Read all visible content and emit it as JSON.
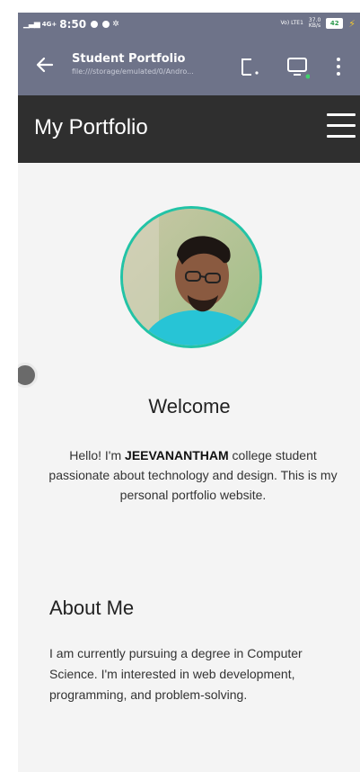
{
  "status_bar": {
    "network": "4G+",
    "time": "8:50",
    "volte": "Vo) LTE1",
    "speed_value": "37.0",
    "speed_unit": "KB/s",
    "battery": "42"
  },
  "browser": {
    "title": "Student Portfolio",
    "url": "file:///storage/emulated/0/Andro..."
  },
  "site": {
    "title": "My Portfolio"
  },
  "hero": {
    "welcome": "Welcome",
    "intro_prefix": "Hello! I'm ",
    "name": "JEEVANANTHAM",
    "intro_suffix": " college student passionate about technology and design. This is my personal portfolio website."
  },
  "about": {
    "heading": "About Me",
    "text": "I am currently pursuing a degree in Computer Science. I'm interested in web development, programming, and problem-solving."
  },
  "colors": {
    "chrome": "#6e7389",
    "header": "#2f2f2f",
    "avatar_border": "#22c3a6",
    "background": "#f4f4f4"
  }
}
